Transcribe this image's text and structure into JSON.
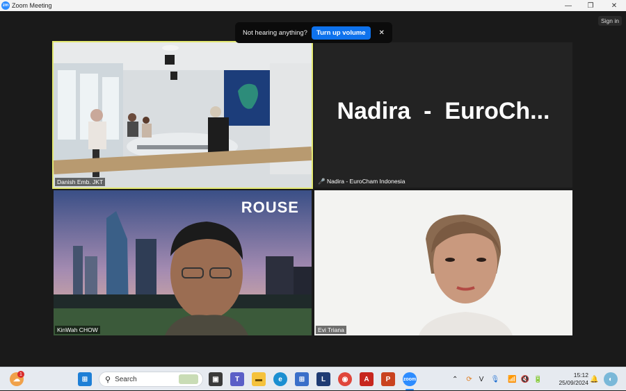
{
  "window": {
    "title": "Zoom Meeting",
    "logo_text": "zm",
    "minimize": "—",
    "restore": "❐",
    "close": "✕"
  },
  "banner": {
    "message": "Not hearing anything?",
    "button": "Turn up volume",
    "close": "✕"
  },
  "signin": "Sign in",
  "tiles": [
    {
      "name": "Danish Emb. JKT",
      "active": true
    },
    {
      "name": "Nadira - EuroCham Indonesia",
      "display_name": "Nadira  -  EuroCh...",
      "muted": true
    },
    {
      "name": "KinWah CHOW",
      "background_text": "ROUSE"
    },
    {
      "name": "Evi Triana"
    }
  ],
  "taskbar": {
    "search_placeholder": "Search",
    "notification_badge": "1",
    "time": "15:12",
    "date": "25/09/2024",
    "apps": [
      "windows-start",
      "task-view",
      "teams",
      "file-explorer",
      "edge",
      "store",
      "l-app",
      "chrome",
      "acrobat",
      "powerpoint",
      "zoom"
    ]
  },
  "colors": {
    "active_speaker": "#e3e870",
    "zoom_blue": "#2d8cff",
    "button_blue": "#0e72ed"
  }
}
